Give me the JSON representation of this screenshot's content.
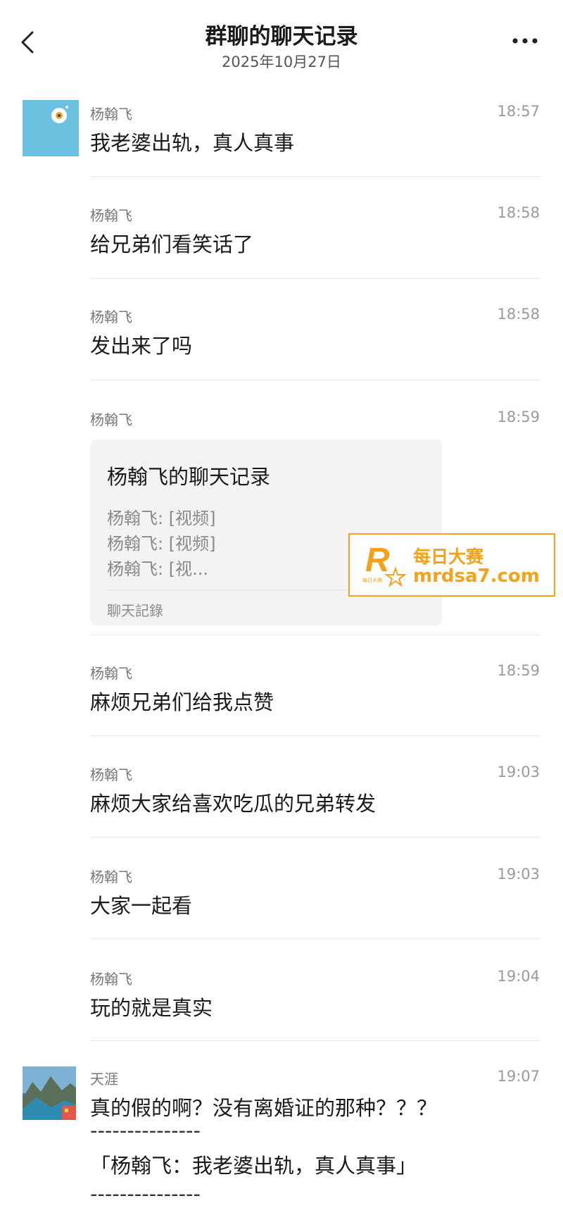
{
  "header": {
    "title": "群聊的聊天记录",
    "date": "2025年10月27日",
    "back_icon": "chevron-left-icon",
    "more_icon": "more-horizontal-icon"
  },
  "messages": [
    {
      "sender": "杨翰飞",
      "time": "18:57",
      "text": "我老婆出轨，真人真事"
    },
    {
      "sender": "杨翰飞",
      "time": "18:58",
      "text": "给兄弟们看笑话了"
    },
    {
      "sender": "杨翰飞",
      "time": "18:58",
      "text": "发出来了吗"
    },
    {
      "sender": "杨翰飞",
      "time": "18:59",
      "card": {
        "title": "杨翰飞的聊天记录",
        "lines": [
          "杨翰飞: [视频]",
          "杨翰飞: [视频]",
          "杨翰飞: [视..."
        ],
        "footer": "聊天記錄"
      }
    },
    {
      "sender": "杨翰飞",
      "time": "18:59",
      "text": "麻烦兄弟们给我点赞"
    },
    {
      "sender": "杨翰飞",
      "time": "19:03",
      "text": "麻烦大家给喜欢吃瓜的兄弟转发"
    },
    {
      "sender": "杨翰飞",
      "time": "19:03",
      "text": "大家一起看"
    },
    {
      "sender": "杨翰飞",
      "time": "19:04",
      "text": "玩的就是真实"
    },
    {
      "sender": "天涯",
      "time": "19:07",
      "text": "真的假的啊？没有离婚证的那种？？？",
      "dashes": "---------------",
      "quote": "「杨翰飞：我老婆出轨，真人真事」",
      "dashes2": "---------------"
    }
  ],
  "watermark": {
    "brand_cn": "每日大赛",
    "url": "mrdsa7.com",
    "logo_text": "每日大赛",
    "color": "#f3a21b"
  },
  "colors": {
    "avatar_bg": "#6cc1e0",
    "card_bg": "#f3f3f3"
  }
}
